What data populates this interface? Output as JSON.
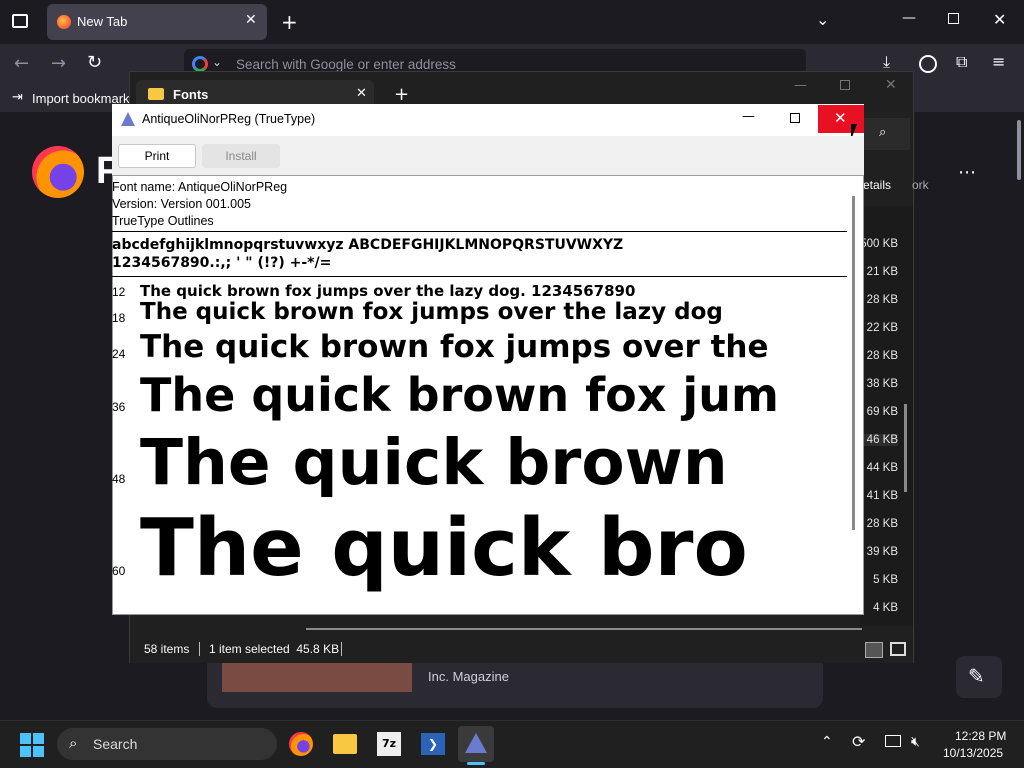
{
  "firefox": {
    "tab_title": "New Tab",
    "url_placeholder": "Search with Google or enter address",
    "import_bookmarks": "Import bookmarks",
    "brand_letter": "F",
    "card_source": "Inc. Magazine"
  },
  "explorer": {
    "tab_title": "Fonts",
    "details_label": "etails",
    "work_label": "ork",
    "sizes": [
      "500 KB",
      "21 KB",
      "28 KB",
      "22 KB",
      "28 KB",
      "38 KB",
      "69 KB",
      "46 KB",
      "44 KB",
      "41 KB",
      "28 KB",
      "39 KB",
      "5 KB",
      "4 KB"
    ],
    "status": {
      "items": "58 items",
      "selected": "1 item selected  45.8 KB"
    }
  },
  "fontviewer": {
    "title": "AntiqueOliNorPReg (TrueType)",
    "print_label": "Print",
    "install_label": "Install",
    "font_name": "Font name: AntiqueOliNorPReg",
    "version": "Version: Version 001.005",
    "outlines": "TrueType Outlines",
    "charset_line1": "abcdefghijklmnopqrstuvwxyz ABCDEFGHIJKLMNOPQRSTUVWXYZ",
    "charset_line2": "1234567890.:,; ' \" (!?) +-*/=",
    "samples": [
      {
        "size": "12",
        "text": "The quick brown fox jumps over the lazy dog. 1234567890"
      },
      {
        "size": "18",
        "text": "The quick brown fox jumps over the lazy dog"
      },
      {
        "size": "24",
        "text": "The quick brown fox jumps over the"
      },
      {
        "size": "36",
        "text": "The quick brown fox jum"
      },
      {
        "size": "48",
        "text": "The quick brown"
      },
      {
        "size": "60",
        "text": "The quick bro"
      }
    ]
  },
  "taskbar": {
    "search_label": "Search",
    "time": "12:28 PM",
    "date": "10/13/2025"
  }
}
